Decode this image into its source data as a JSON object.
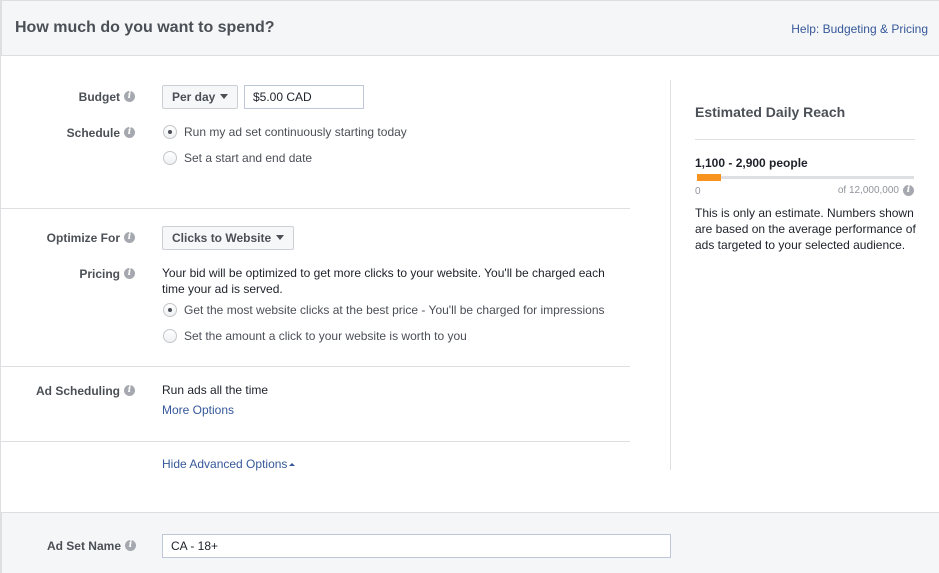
{
  "header": {
    "title": "How much do you want to spend?",
    "help_link": "Help: Budgeting & Pricing"
  },
  "budget": {
    "label": "Budget",
    "period_selected": "Per day",
    "amount_value": "$5.00 CAD"
  },
  "schedule": {
    "label": "Schedule",
    "options": [
      {
        "label": "Run my ad set continuously starting today",
        "checked": true
      },
      {
        "label": "Set a start and end date",
        "checked": false
      }
    ]
  },
  "optimize": {
    "label": "Optimize For",
    "selected": "Clicks to Website"
  },
  "pricing": {
    "label": "Pricing",
    "description": "Your bid will be optimized to get more clicks to your website. You'll be charged each time your ad is served.",
    "options": [
      {
        "label": "Get the most website clicks at the best price - You'll be charged for impressions",
        "checked": true
      },
      {
        "label": "Set the amount a click to your website is worth to you",
        "checked": false
      }
    ]
  },
  "ad_scheduling": {
    "label": "Ad Scheduling",
    "value": "Run ads all the time",
    "more_options": "More Options"
  },
  "advanced": {
    "toggle_label": "Hide Advanced Options"
  },
  "reach": {
    "title": "Estimated Daily Reach",
    "range": "1,100 - 2,900 people",
    "min_label": "0",
    "max_label": "of 12,000,000",
    "fill_fraction": 0.11,
    "fill_color": "#f7931e",
    "description": "This is only an estimate. Numbers shown are based on the average performance of ads targeted to your selected audience."
  },
  "ad_set_name": {
    "label": "Ad Set Name",
    "value": "CA - 18+"
  },
  "icons": {
    "info": "i"
  }
}
